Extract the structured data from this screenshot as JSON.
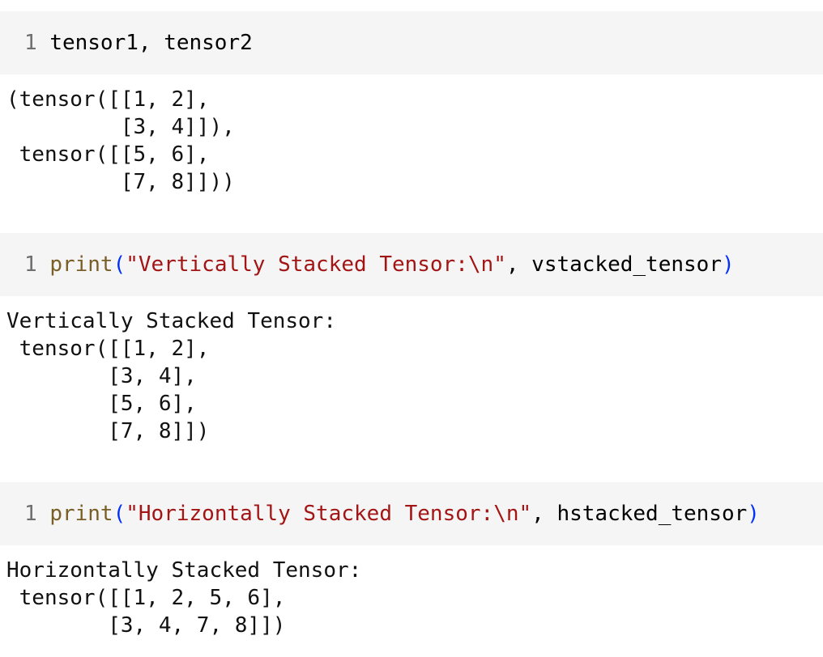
{
  "cells": [
    {
      "line_number": "1",
      "code": "tensor1, tensor2",
      "output": "(tensor([[1, 2],\n         [3, 4]]),\n tensor([[5, 6],\n         [7, 8]]))"
    },
    {
      "line_number": "1",
      "fn": "print",
      "open_paren": "(",
      "string": "\"Vertically Stacked Tensor:\\n\"",
      "rest": ", vstacked_tensor",
      "close_paren": ")",
      "output": "Vertically Stacked Tensor:\n tensor([[1, 2],\n        [3, 4],\n        [5, 6],\n        [7, 8]])"
    },
    {
      "line_number": "1",
      "fn": "print",
      "open_paren": "(",
      "string": "\"Horizontally Stacked Tensor:\\n\"",
      "rest": ", hstacked_tensor",
      "close_paren": ")",
      "output": "Horizontally Stacked Tensor:\n tensor([[1, 2, 5, 6],\n        [3, 4, 7, 8]])"
    }
  ],
  "colors": {
    "input_background": "#f5f5f5",
    "function": "#795e26",
    "string": "#a31515",
    "paren": "#0431fa",
    "line_number": "#6e6e6e"
  }
}
